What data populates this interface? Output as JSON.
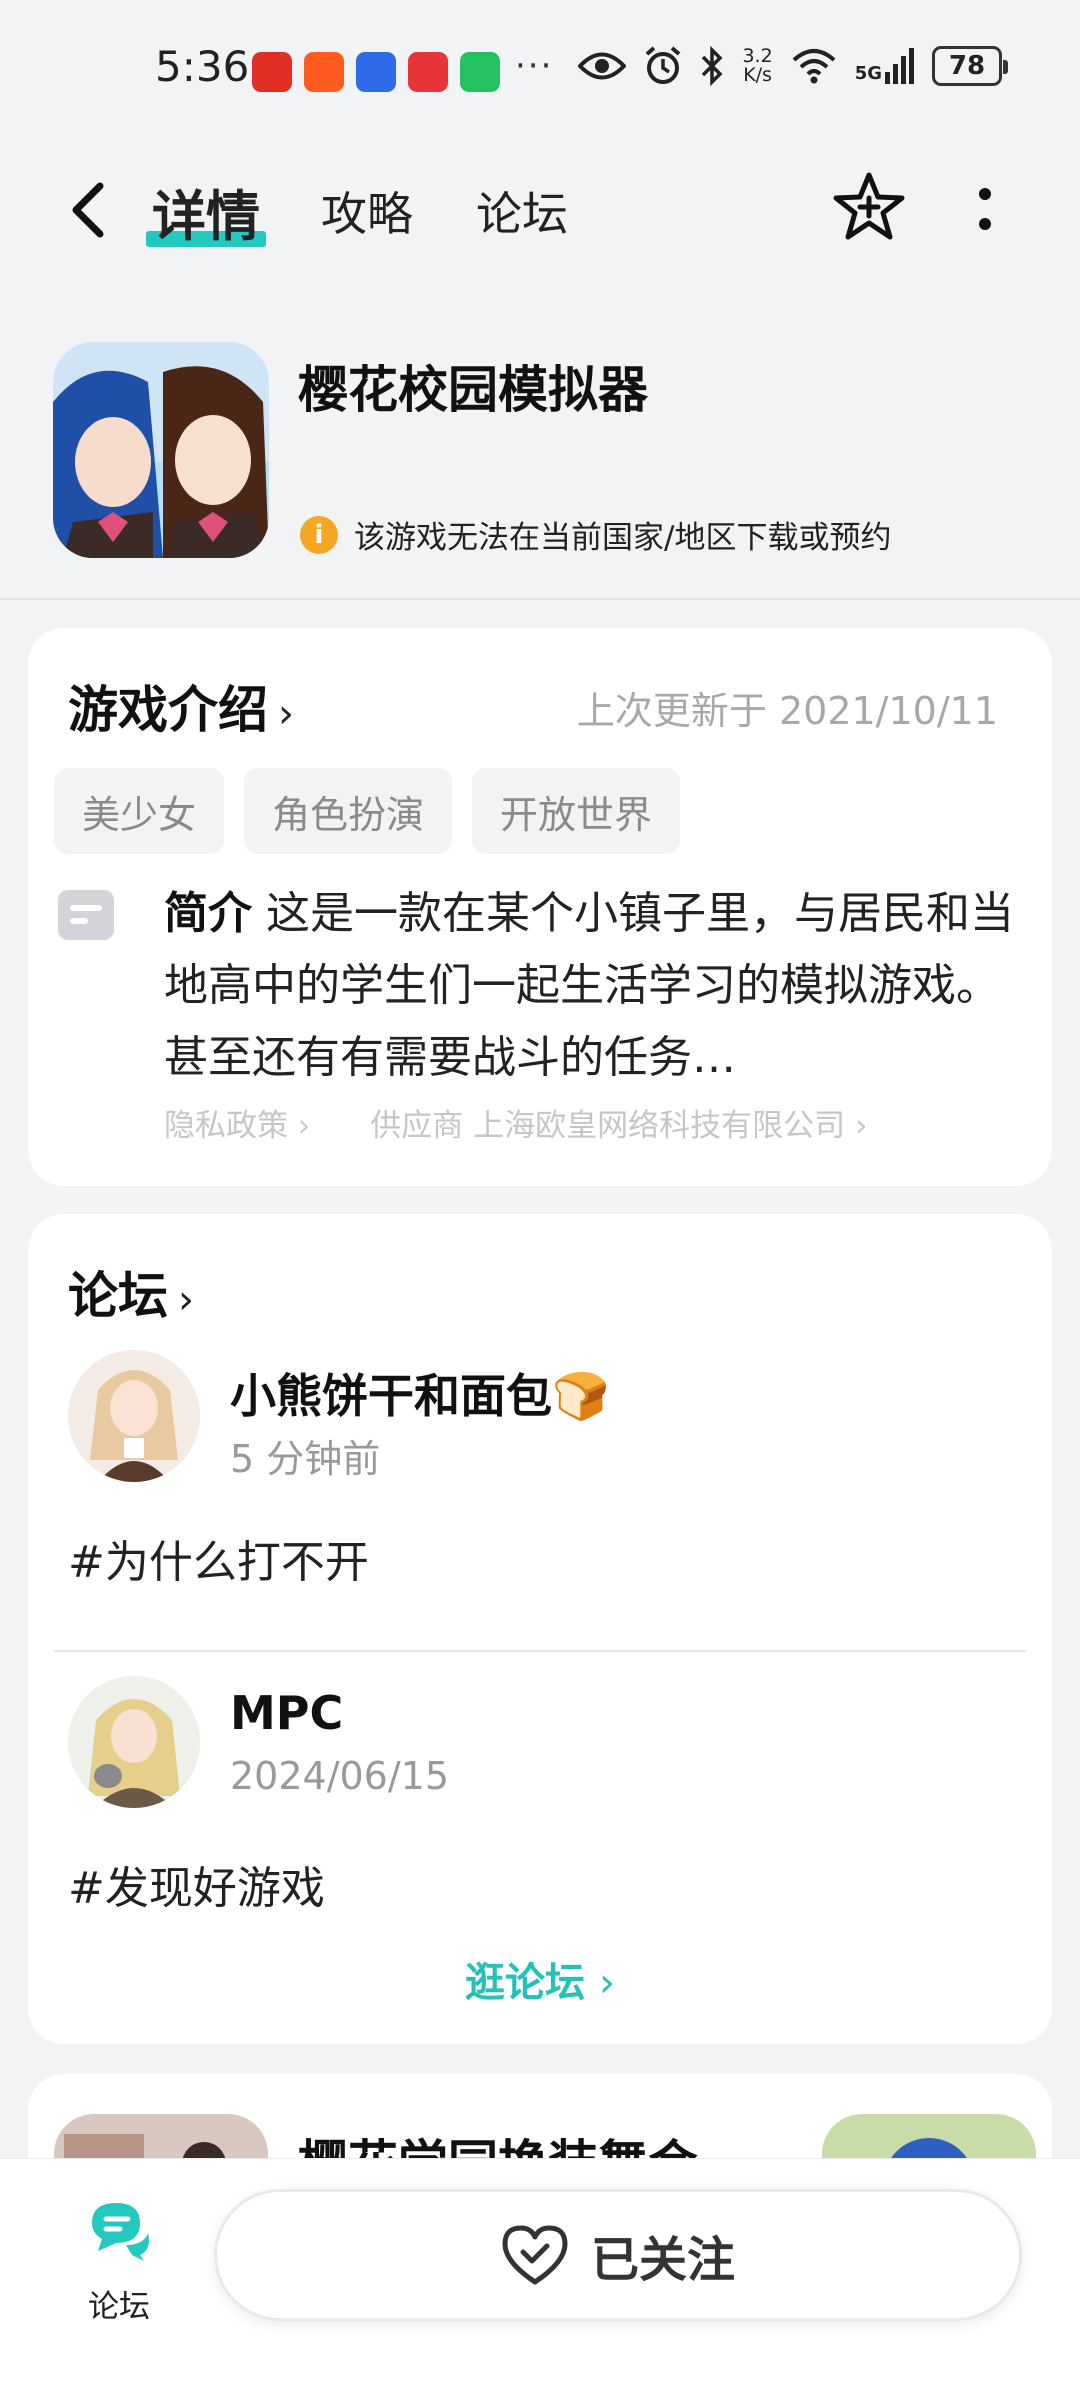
{
  "status_bar": {
    "time": "5:36",
    "net_speed_value": "3.2",
    "net_speed_unit": "K/s",
    "network": "5G",
    "battery": "78",
    "more_indicator": "···",
    "app_icons": [
      "pinduoduo-icon",
      "taobao-icon",
      "baidu-icon",
      "huawei-store-icon",
      "wechat-icon"
    ],
    "app_colors": [
      "#e02e24",
      "#ff5a1f",
      "#2e6be6",
      "#e8353b",
      "#23c160"
    ]
  },
  "nav": {
    "tabs": [
      "详情",
      "攻略",
      "论坛"
    ],
    "active_tab": "详情",
    "accent_color": "#23c9be"
  },
  "game": {
    "title": "樱花校园模拟器",
    "notice": "该游戏无法在当前国家/地区下载或预约"
  },
  "intro": {
    "section_title": "游戏介绍",
    "updated": "上次更新于 2021/10/11",
    "tags": [
      "美少女",
      "角色扮演",
      "开放世界"
    ],
    "desc_label": "简介",
    "desc_text": "这是一款在某个小镇子里，与居民和当地高中的学生们一起生活学习的模拟游戏。 甚至还有有需要战斗的任务…",
    "privacy_link": "隐私政策",
    "supplier_link": "供应商 上海欧皇网络科技有限公司"
  },
  "forum": {
    "section_title": "论坛",
    "posts": [
      {
        "user": "小熊饼干和面包🍞",
        "time": "5 分钟前",
        "text": "#为什么打不开"
      },
      {
        "user": "MPC",
        "time": "2024/06/15",
        "text": "#发现好游戏"
      }
    ],
    "visit_label": "逛论坛"
  },
  "related": {
    "title": "樱花学园换装舞会"
  },
  "bottom": {
    "forum_tab_label": "论坛",
    "follow_label": "已关注"
  }
}
